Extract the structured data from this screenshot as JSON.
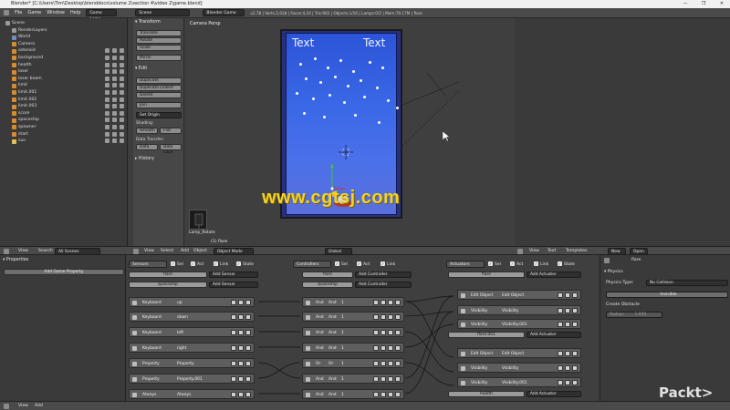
{
  "window": {
    "title": "Blender* [C:\\Users\\Tim\\Desktop\\blenddocs\\volume 2\\section 4\\video 2\\game.blend]",
    "controls": [
      "—",
      "❐",
      "✕"
    ]
  },
  "topmenu": {
    "items": [
      "File",
      "Game",
      "Window",
      "Help"
    ],
    "layout": "Game Logic",
    "scene": "Scene",
    "engine": "Blender Game",
    "stats": "v2.78 | Verts:2,018 | Faces:4,10 | Tris:902 | Objects:1/16 | Lamps:0/2 | Mem:79.17M | flare"
  },
  "outliner": {
    "items": [
      {
        "label": "Scene"
      },
      {
        "label": "RenderLayers"
      },
      {
        "label": "World"
      },
      {
        "label": "Camera"
      },
      {
        "label": "asteroid"
      },
      {
        "label": "background"
      },
      {
        "label": "health"
      },
      {
        "label": "laser"
      },
      {
        "label": "laser beam"
      },
      {
        "label": "limit"
      },
      {
        "label": "limit.001"
      },
      {
        "label": "limit.002"
      },
      {
        "label": "limit.003"
      },
      {
        "label": "score"
      },
      {
        "label": "spaceship"
      },
      {
        "label": "spawner"
      },
      {
        "label": "start"
      },
      {
        "label": "sun"
      }
    ]
  },
  "toolshelf": {
    "transform_header": "▾ Transform",
    "translate": "Translate",
    "rotate": "Rotate",
    "scale": "Scale",
    "mirror": "Mirror",
    "edit_header": "▾ Edit",
    "duplicate": "Duplicate",
    "duplicate_linked": "Duplicate Linked",
    "delete": "Delete",
    "join": "Join",
    "set_origin": "Set Origin",
    "shading_label": "Shading:",
    "smooth": "Smooth",
    "flat": "Flat",
    "data_transfer_label": "Data Transfer:",
    "data": "Data",
    "data_layout": "Data Layo",
    "history_header": "▸ History"
  },
  "viewport": {
    "title": "Camera Persp",
    "game_text_left": "Text",
    "game_text_right": "Text",
    "watermark": "www.cgtsj.com",
    "lamp_label": "Lamp_Rotate",
    "object_label": "(1) flare"
  },
  "midheader": {
    "left_view": "View",
    "left_search": "Search",
    "left_scenes": "All Scenes",
    "vp_items": [
      "View",
      "Select",
      "Add",
      "Object"
    ],
    "vp_mode": "Object Mode",
    "vp_orient": "Global",
    "txt_items": [
      "View",
      "Text",
      "Templates"
    ],
    "txt_new": "New",
    "txt_open": "Open"
  },
  "props_left": {
    "header": "▾ Properties",
    "add_button": "Add Game Property"
  },
  "logic": {
    "sensors": {
      "header": "Sensors",
      "toggles": [
        "Sel",
        "Act",
        "Link",
        "State"
      ],
      "object1": "flare",
      "add1": "Add Sensor",
      "object2": "spaceship",
      "add2": "Add Sensor",
      "bricks": [
        {
          "type": "Keyboard",
          "value": "up"
        },
        {
          "type": "Keyboard",
          "value": "down"
        },
        {
          "type": "Keyboard",
          "value": "left"
        },
        {
          "type": "Keyboard",
          "value": "right"
        },
        {
          "type": "Property",
          "value": "Property"
        },
        {
          "type": "Property",
          "value": "Property.001"
        },
        {
          "type": "Always",
          "value": "Always"
        }
      ]
    },
    "controllers": {
      "header": "Controllers",
      "toggles": [
        "Sel",
        "Act",
        "Link"
      ],
      "object1": "flare",
      "add1": "Add Controller",
      "object2": "spaceship",
      "add2": "Add Controller",
      "bricks": [
        {
          "type": "And",
          "name": "And",
          "num": "1"
        },
        {
          "type": "And",
          "name": "And",
          "num": "1"
        },
        {
          "type": "And",
          "name": "And",
          "num": "1"
        },
        {
          "type": "And",
          "name": "And",
          "num": "1"
        },
        {
          "type": "Or",
          "name": "Or",
          "num": "1"
        },
        {
          "type": "And",
          "name": "And",
          "num": "1"
        },
        {
          "type": "And",
          "name": "And",
          "num": "1"
        }
      ]
    },
    "actuators": {
      "header": "Actuators",
      "toggles": [
        "Sel",
        "Act",
        "Link",
        "State"
      ],
      "object1": "flare",
      "bricks_top": [
        {
          "type": "Edit Object",
          "value": "Edit Object"
        },
        {
          "type": "Visibility",
          "value": "Visibility"
        },
        {
          "type": "Visibility",
          "value": "Visibility.001"
        }
      ],
      "object2": "flare.001",
      "add2": "Add Actuator",
      "bricks_bottom": [
        {
          "type": "Edit Object",
          "value": "Edit Object"
        },
        {
          "type": "Visibility",
          "value": "Visibility"
        },
        {
          "type": "Visibility",
          "value": "Visibility.001"
        }
      ],
      "object3": "health",
      "add3": "Add Actuator",
      "add1": "Add Actuator"
    }
  },
  "props_br": {
    "object_name": "flare",
    "physics_header": "▾ Physics",
    "physics_type_label": "Physics Type:",
    "physics_type_value": "No Collision",
    "invisible": "Invisible",
    "create_obstacle": "Create Obstacle",
    "radius_label": "Radius:",
    "radius_value": "1.000"
  },
  "bottomstrip": {
    "items": [
      "View",
      "Add"
    ]
  },
  "brand": {
    "logo": "Packt>"
  },
  "colors": {
    "object_icon": "#d88c2f",
    "game_bg_top": "#2c54d8",
    "watermark": "#f2d323"
  }
}
